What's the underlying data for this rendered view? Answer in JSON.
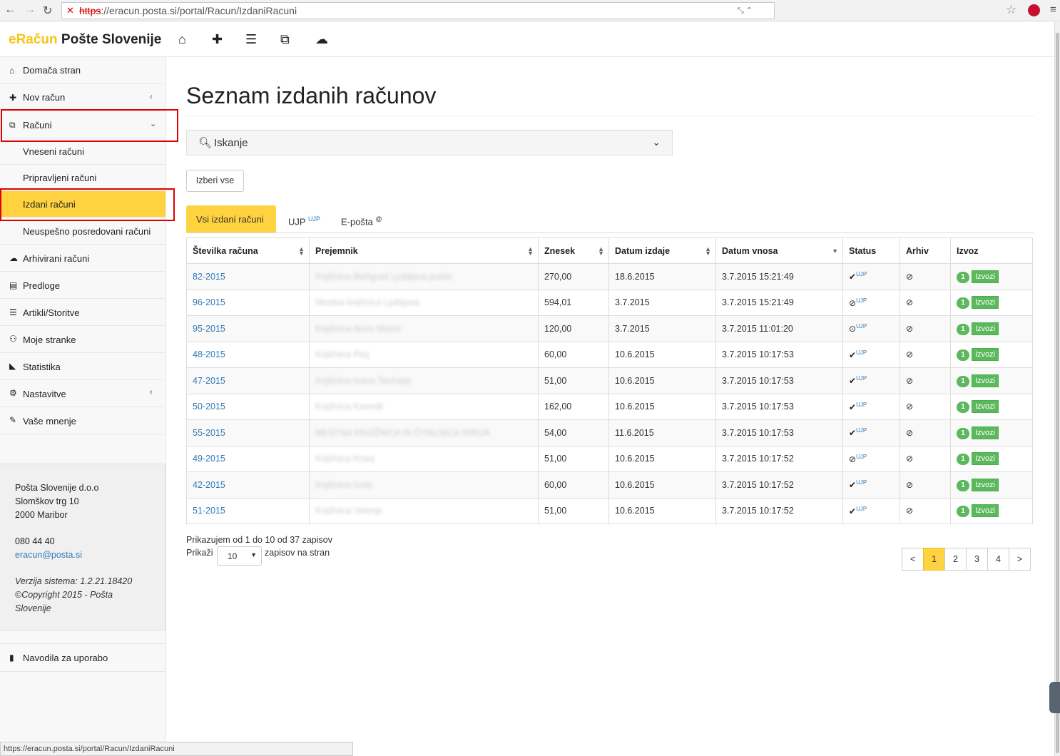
{
  "browser": {
    "url_scheme": "https",
    "url_rest": "://eracun.posta.si/portal/Racun/IzdaniRacuni",
    "status_url": "https://eracun.posta.si/portal/Racun/IzdaniRacuni"
  },
  "brand": {
    "part1": "eRačun",
    "part2": " Pošte Slovenije",
    "accent": "#ffd23f"
  },
  "top_icons": [
    "home-icon",
    "plus-icon",
    "list-icon",
    "copy-icon",
    "cloud-icon"
  ],
  "sidebar": {
    "items": [
      {
        "label": "Domača stran",
        "icon": "⌂"
      },
      {
        "label": "Nov račun",
        "icon": "✚"
      },
      {
        "label": "Računi",
        "icon": "⧉"
      },
      {
        "label": "Vneseni računi"
      },
      {
        "label": "Pripravljeni računi"
      },
      {
        "label": "Izdani računi"
      },
      {
        "label": "Neuspešno posredovani računi"
      },
      {
        "label": "Arhivirani računi",
        "icon": "☁"
      },
      {
        "label": "Predloge",
        "icon": "🗎"
      },
      {
        "label": "Artikli/Storitve",
        "icon": "☰"
      },
      {
        "label": "Moje stranke",
        "icon": "👥"
      },
      {
        "label": "Statistika",
        "icon": "📈"
      },
      {
        "label": "Nastavitve",
        "icon": "⚙"
      },
      {
        "label": "Vaše mnenje",
        "icon": "✎"
      },
      {
        "label": "Navodila za uporabo",
        "icon": "📕"
      }
    ],
    "info": {
      "company": "Pošta Slovenije d.o.o",
      "street": "Slomškov trg 10",
      "city": "2000 Maribor",
      "phone": "080 44 40",
      "email": "eracun@posta.si",
      "version": "Verzija sistema: 1.2.21.18420",
      "copyright1": "©Copyright 2015 - Pošta",
      "copyright2": "Slovenije"
    }
  },
  "main": {
    "title": "Seznam izdanih računov",
    "search_label": "Iskanje",
    "select_all": "Izberi vse",
    "tabs": [
      {
        "label": "Vsi izdani računi",
        "sup": ""
      },
      {
        "label": "UJP",
        "sup": "UJP"
      },
      {
        "label": "E-pošta",
        "sup": "@"
      }
    ],
    "columns": [
      "Številka računa",
      "Prejemnik",
      "Znesek",
      "Datum izdaje",
      "Datum vnosa",
      "Status",
      "Arhiv",
      "Izvoz"
    ],
    "rows": [
      {
        "nr": "82-2015",
        "recipient": "Knjižnica Bežigrad Ljubljana public",
        "amount": "270,00",
        "issued": "18.6.2015",
        "entered": "3.7.2015 15:21:49",
        "status": "✔",
        "badge": "1"
      },
      {
        "nr": "96-2015",
        "recipient": "Mestna knjižnica Ljubljana",
        "amount": "594,01",
        "issued": "3.7.2015",
        "entered": "3.7.2015 15:21:49",
        "status": "⊘",
        "badge": "1"
      },
      {
        "nr": "95-2015",
        "recipient": "Knjižnica Novo Mesto",
        "amount": "120,00",
        "issued": "3.7.2015",
        "entered": "3.7.2015 11:01:20",
        "status": "⊙",
        "badge": "1"
      },
      {
        "nr": "48-2015",
        "recipient": "Knjižnica Ptuj",
        "amount": "60,00",
        "issued": "10.6.2015",
        "entered": "3.7.2015 10:17:53",
        "status": "✔",
        "badge": "1"
      },
      {
        "nr": "47-2015",
        "recipient": "Knjižnica Ivana Tavčarja",
        "amount": "51,00",
        "issued": "10.6.2015",
        "entered": "3.7.2015 10:17:53",
        "status": "✔",
        "badge": "1"
      },
      {
        "nr": "50-2015",
        "recipient": "Knjižnica Kamnik",
        "amount": "162,00",
        "issued": "10.6.2015",
        "entered": "3.7.2015 10:17:53",
        "status": "✔",
        "badge": "1"
      },
      {
        "nr": "55-2015",
        "recipient": "MESTNA KNJIŽNICA IN ČITALNICA IDRIJA",
        "amount": "54,00",
        "issued": "11.6.2015",
        "entered": "3.7.2015 10:17:53",
        "status": "✔",
        "badge": "1"
      },
      {
        "nr": "49-2015",
        "recipient": "Knjižnica Kranj",
        "amount": "51,00",
        "issued": "10.6.2015",
        "entered": "3.7.2015 10:17:52",
        "status": "⊘",
        "badge": "1"
      },
      {
        "nr": "42-2015",
        "recipient": "Knjižnica Izola",
        "amount": "60,00",
        "issued": "10.6.2015",
        "entered": "3.7.2015 10:17:52",
        "status": "✔",
        "badge": "1"
      },
      {
        "nr": "51-2015",
        "recipient": "Knjižnica Velenje",
        "amount": "51,00",
        "issued": "10.6.2015",
        "entered": "3.7.2015 10:17:52",
        "status": "✔",
        "badge": "1"
      }
    ],
    "ujp_mark": "UJP",
    "export_label": "Izvozi",
    "showing": "Prikazujem od 1 do 10 od 37 zapisov",
    "show_label": "Prikaži",
    "per_page": "10",
    "per_page_suffix": "zapisov na stran",
    "pager": [
      "<",
      "1",
      "2",
      "3",
      "4",
      ">"
    ]
  }
}
